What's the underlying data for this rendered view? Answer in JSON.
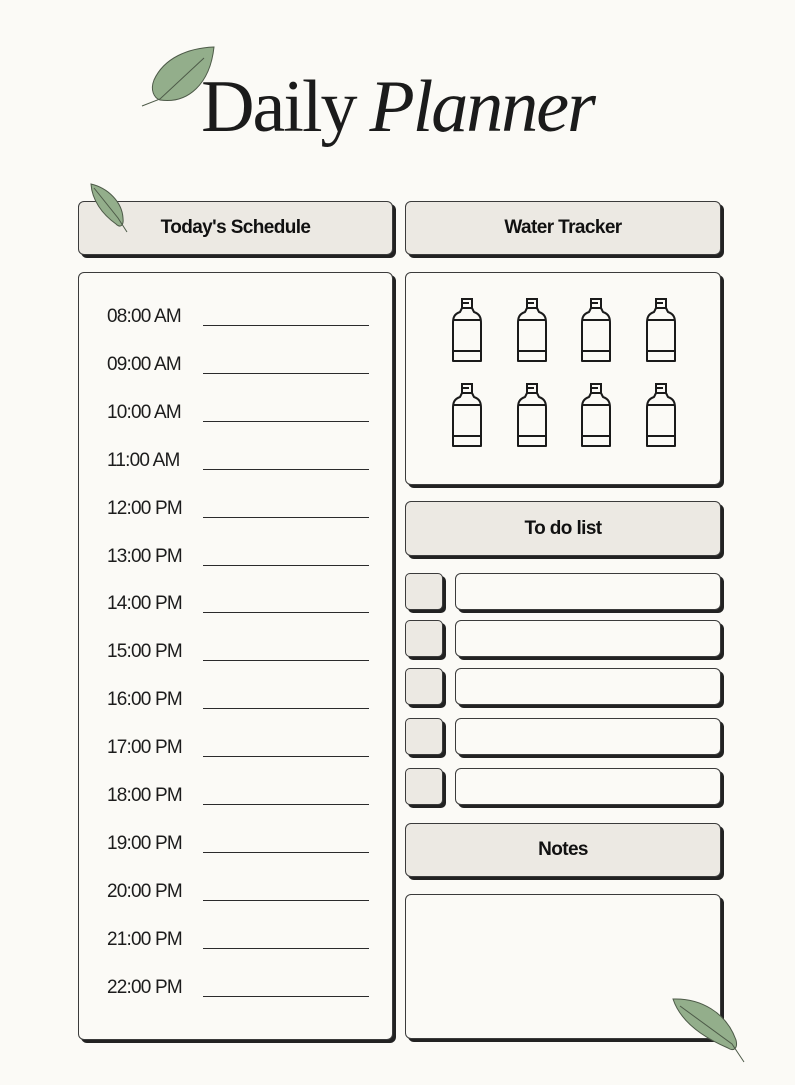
{
  "title": {
    "word1": "Daily",
    "word2": "Planner"
  },
  "schedule": {
    "header": "Today's Schedule",
    "times": [
      "08:00 AM",
      "09:00 AM",
      "10:00 AM",
      "11:00 AM",
      "12:00 PM",
      "13:00 PM",
      "14:00 PM",
      "15:00 PM",
      "16:00 PM",
      "17:00 PM",
      "18:00 PM",
      "19:00 PM",
      "20:00 PM",
      "21:00 PM",
      "22:00 PM"
    ]
  },
  "water": {
    "header": "Water Tracker",
    "bottle_count": 8,
    "icon": "water-bottle-icon"
  },
  "todo": {
    "header": "To do list",
    "item_count": 5
  },
  "notes": {
    "header": "Notes"
  },
  "colors": {
    "background": "#fbfaf6",
    "header_fill": "#ece9e3",
    "leaf": "#93ae8b",
    "ink": "#1a1a1a"
  }
}
